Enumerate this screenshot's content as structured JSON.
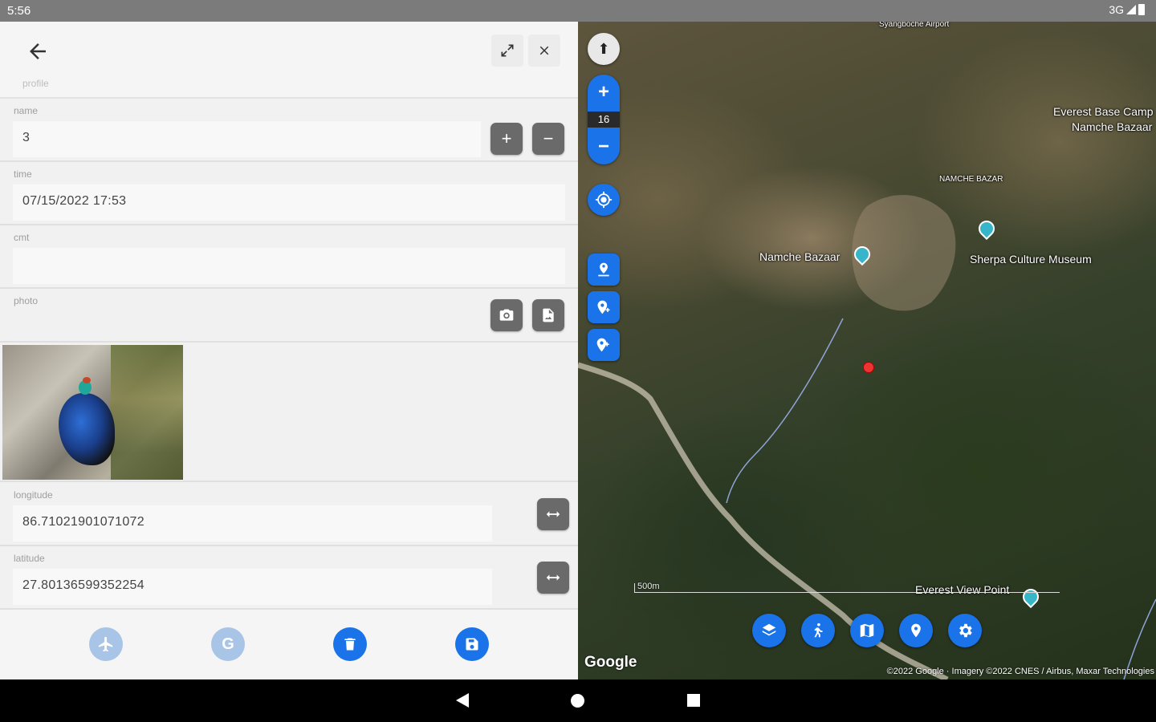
{
  "status_bar": {
    "time": "5:56",
    "network": "3G"
  },
  "toolbar": {
    "back_icon": "arrow-left-icon",
    "expand_icon": "expand-icon",
    "close_icon": "close-icon",
    "profile_label": "profile"
  },
  "form": {
    "name": {
      "label": "name",
      "value": "3",
      "increment": "+",
      "decrement": "−"
    },
    "time": {
      "label": "time",
      "value": "07/15/2022 17:53"
    },
    "cmt": {
      "label": "cmt",
      "value": ""
    },
    "photo": {
      "label": "photo",
      "camera_icon": "camera-icon",
      "file_icon": "file-image-icon"
    },
    "longitude": {
      "label": "longitude",
      "value": "86.71021901071072",
      "swap_icon": "swap-horizontal-icon"
    },
    "latitude": {
      "label": "latitude",
      "value": "27.80136599352254",
      "swap_icon": "swap-horizontal-icon"
    }
  },
  "bottom_actions": {
    "airplane_icon": "airplane-icon",
    "google_label": "G",
    "delete_icon": "trash-icon",
    "save_icon": "save-icon"
  },
  "map": {
    "zoom_level": "16",
    "zoom_in": "+",
    "zoom_out": "−",
    "labels": {
      "everest_base_camp": "Everest Base Camp",
      "namche_bazaar_top": "Namche Bazaar",
      "namche_bazar_small": "NAMCHE BAZAR",
      "namche_bazaar": "Namche Bazaar",
      "sherpa_museum": "Sherpa Culture Museum",
      "everest_view_point": "Everest View Point",
      "top_cut": "Syangboche Airport"
    },
    "scale_label": "500m",
    "google_logo": "Google",
    "attribution": "©2022 Google · Imagery ©2022 CNES / Airbus, Maxar Technologies",
    "bottom_buttons": [
      "layers-icon",
      "walk-icon",
      "map-icon",
      "pin-icon",
      "settings-icon"
    ]
  },
  "colors": {
    "accent": "#1a73e8",
    "dim_accent": "#a8c4e6",
    "button_grey": "#6a6a6a"
  }
}
